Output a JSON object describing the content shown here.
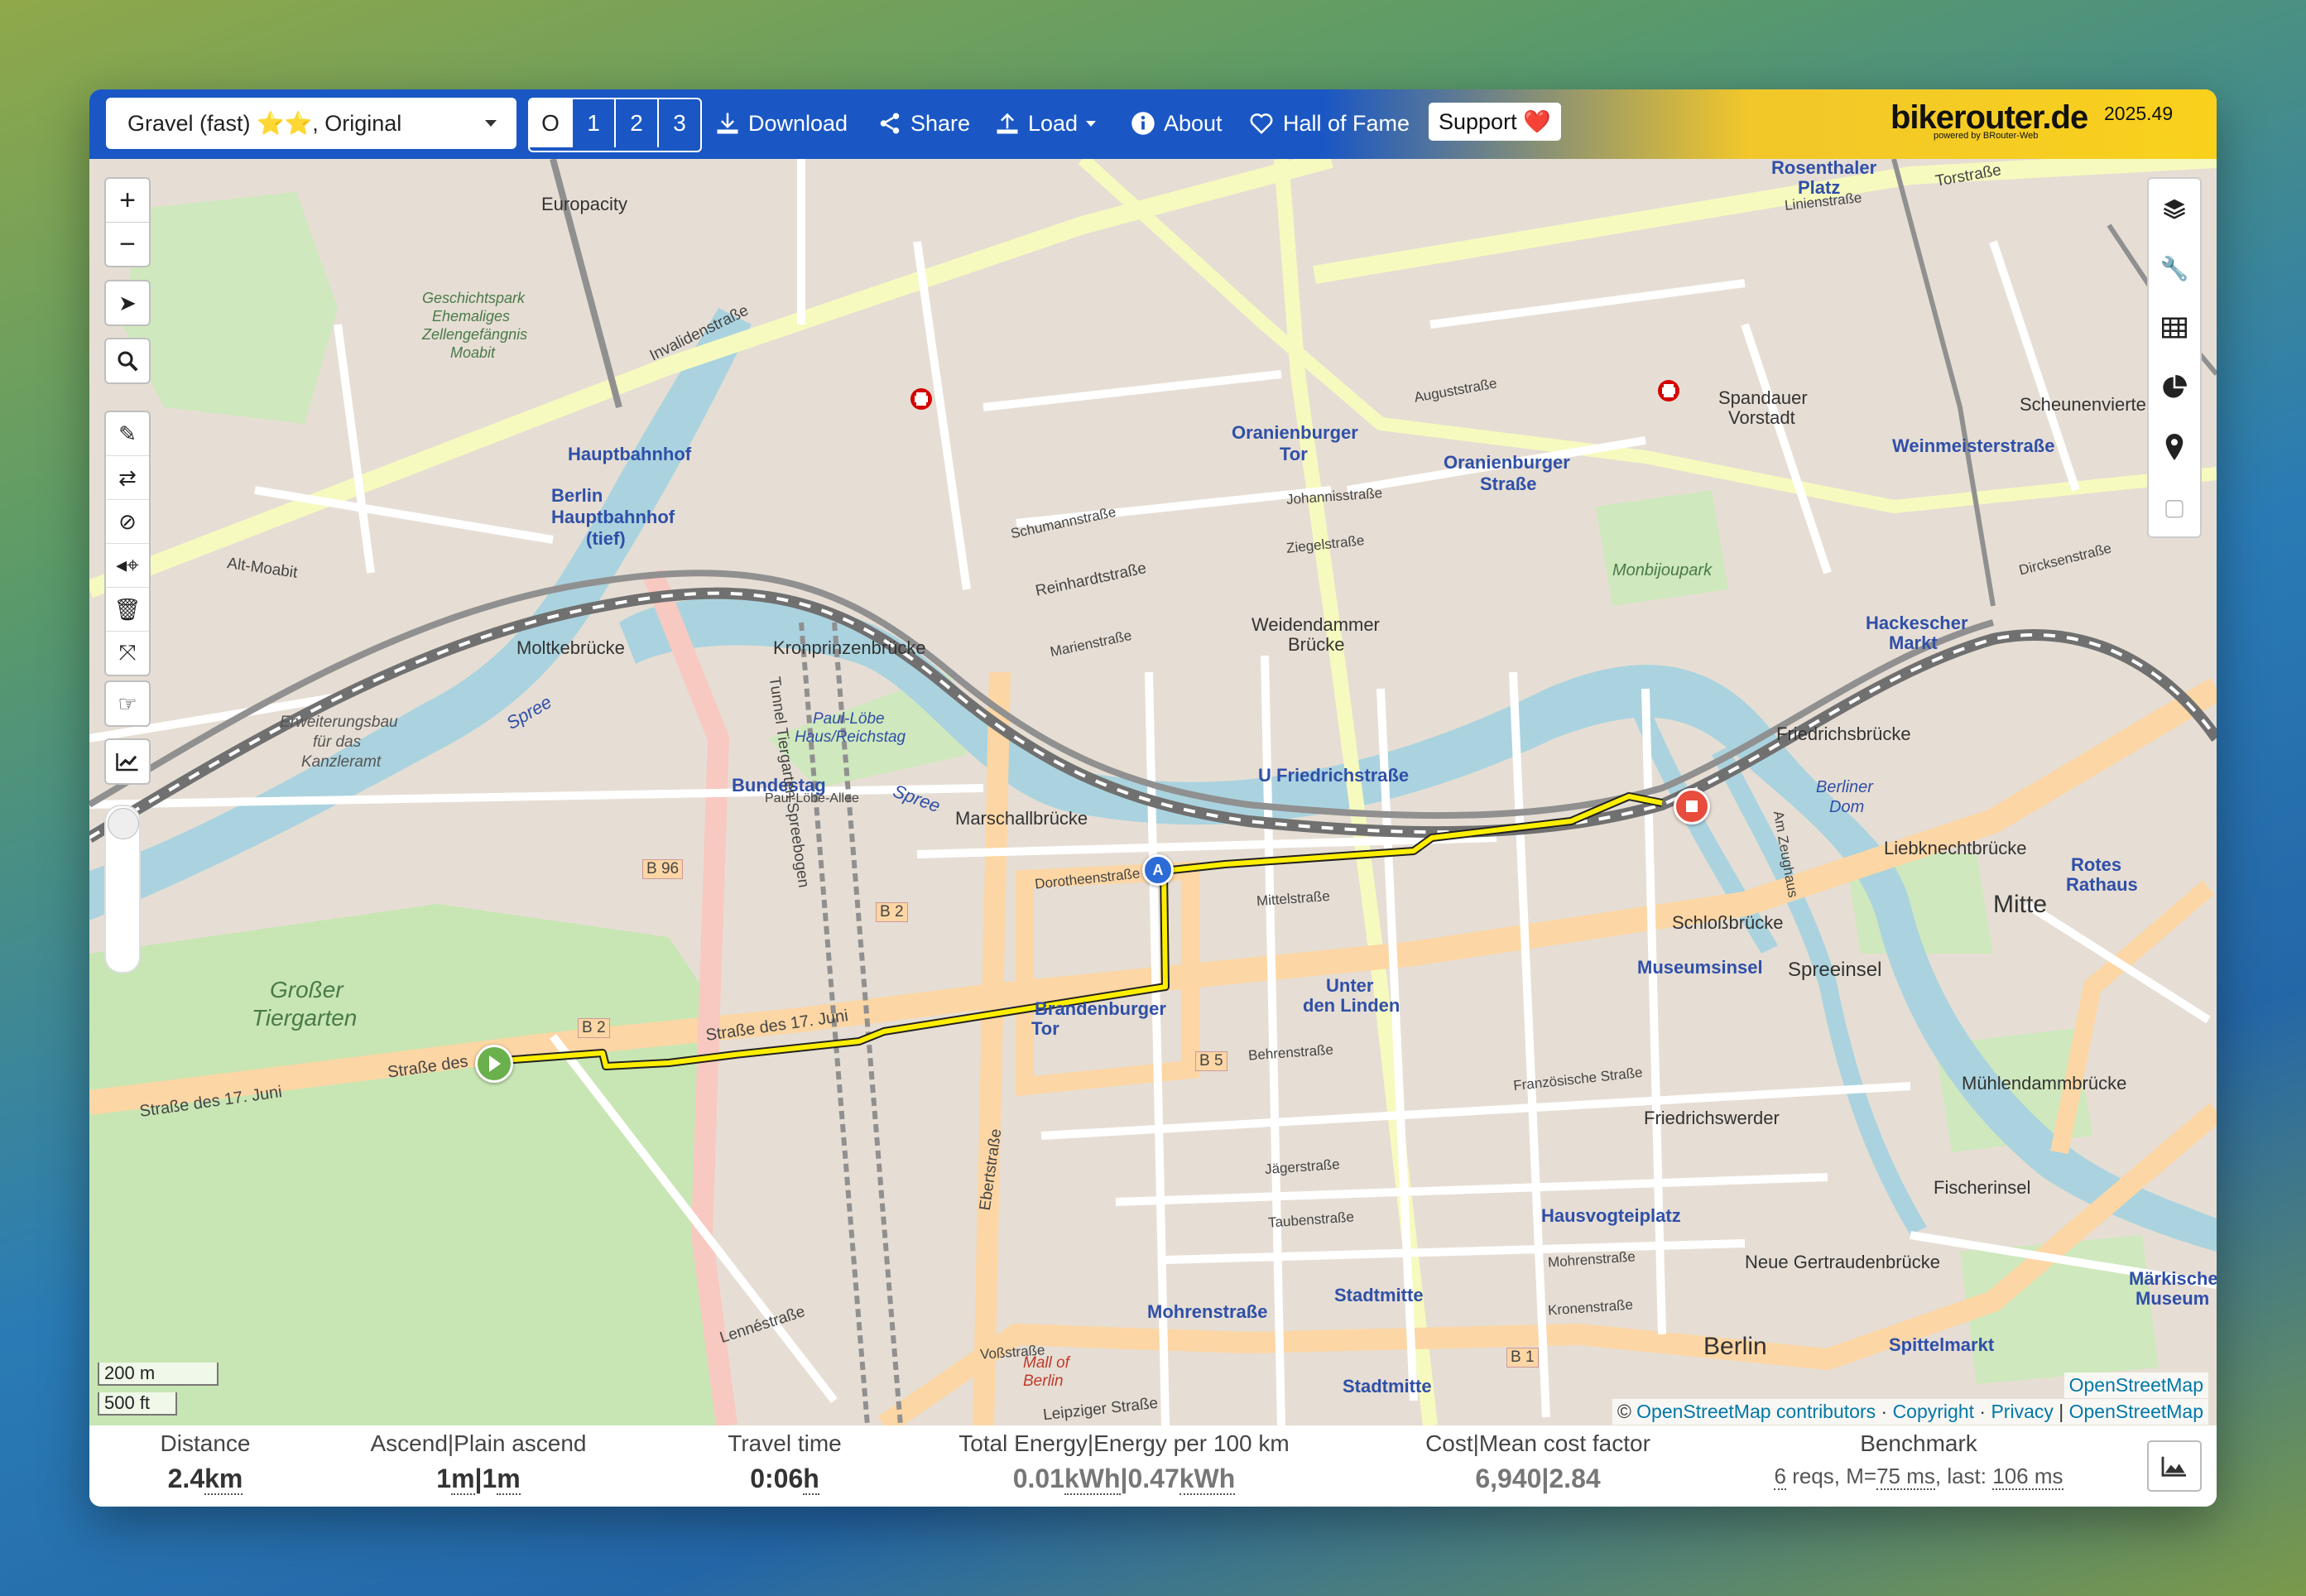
{
  "header": {
    "profile_select": "Gravel (fast) ⭐⭐, Original",
    "alternatives": [
      "O",
      "1",
      "2",
      "3"
    ],
    "download": "Download",
    "share": "Share",
    "load": "Load",
    "about": "About",
    "hall_of_fame": "Hall of Fame",
    "support": "Support ❤️",
    "brand": "bikerouter.de",
    "brand_sub": "powered by BRouter-Web",
    "version": "2025.49"
  },
  "map": {
    "labels": {
      "europacity": "Europacity",
      "hauptbahnhof": "Hauptbahnhof",
      "berlin_hbf": "Berlin",
      "berlin_hbf2": "Hauptbahnhof",
      "berlin_hbf3": "(tief)",
      "moltkebruecke": "Moltkebrücke",
      "kronprinzenbruecke": "Kronprinzenbrücke",
      "bundestag": "Bundestag",
      "paul_loebe_allee": "Paul-Löbe-Allee",
      "marschallbruecke": "Marschallbrücke",
      "grosser_tiergarten1": "Großer",
      "grosser_tiergarten2": "Tiergarten",
      "strasse_17_juni_a": "Straße des 17. Juni",
      "strasse_17_juni_b": "Straße des 17. Juni",
      "strasse_des": "Straße des",
      "oranienburger_tor1": "Oranienburger",
      "oranienburger_tor2": "Tor",
      "oranienburger_strasse1": "Oranienburger",
      "oranienburger_strasse2": "Straße",
      "weidendammer1": "Weidendammer",
      "weidendammer2": "Brücke",
      "friedrichstrasse": "U Friedrichstraße",
      "hackescher1": "Hackescher",
      "hackescher2": "Markt",
      "weinmeisterstrasse": "Weinmeisterstraße",
      "torstrasse": "Torstraße",
      "rosenthaler1": "Rosenthaler",
      "rosenthaler2": "Platz",
      "spandauer1": "Spandauer",
      "spandauer2": "Vorstadt",
      "scheunenviertel": "Scheunenviertel",
      "monbijoupark": "Monbijoupark",
      "friedrichsbruecke": "Friedrichsbrücke",
      "liebknechtbruecke": "Liebknechtbrücke",
      "berliner_dom1": "Berliner",
      "berliner_dom2": "Dom",
      "rotes_rathaus1": "Rotes",
      "rotes_rathaus2": "Rathaus",
      "mitte": "Mitte",
      "schlossbruecke": "Schloßbrücke",
      "museumsinsel": "Museumsinsel",
      "spreeinsel": "Spreeinsel",
      "unter_den_linden1": "Unter",
      "unter_den_linden2": "den Linden",
      "brandenburger_tor": "Brandenburger",
      "brandenburger_tor2": "Tor",
      "hausvogteiplatz": "Hausvogteiplatz",
      "stadtmitte": "Stadtmitte",
      "stadtmitte2": "Stadtmitte",
      "mohrenstrasse": "Mohrenstraße",
      "muehlendammbruecke": "Mühlendammbrücke",
      "fischerinsel": "Fischerinsel",
      "neue_gertrauden": "Neue Gertraudenbrücke",
      "berlin": "Berlin",
      "spittelmarkt": "Spittelmarkt",
      "maerkisches1": "Märkisches",
      "maerkisches2": "Museum",
      "friedrichswerder": "Friedrichswerder",
      "invalidenstrasse": "Invalidenstraße",
      "alt_moabit": "Alt-Moabit",
      "lennestrasse": "Lennéstraße",
      "leipziger": "Leipziger Straße",
      "ebertstrasse": "Ebertstraße",
      "tunnel_tiergarten": "Tunnel Tiergarten Spreebogen",
      "geschichtspark1": "Geschichtspark",
      "geschichtspark2": "Ehemaliges",
      "geschichtspark3": "Zellengefängnis",
      "geschichtspark4": "Moabit",
      "erweiterungsbau1": "Erweiterungsbau",
      "erweiterungsbau2": "für das",
      "erweiterungsbau3": "Kanzleramt",
      "poul_loebe1": "Paul-Löbe",
      "poul_loebe2": "Haus/Reichstag",
      "b96": "B 96",
      "b2a": "B 2",
      "b2b": "B 2",
      "b5": "B 5",
      "b1": "B 1",
      "spree": "Spree",
      "spree2": "Spree",
      "am_zeughaus": "Am Zeughaus",
      "reinhardtstrasse": "Reinhardtstraße",
      "schumannstrasse": "Schumannstraße",
      "dorotheenstrasse": "Dorotheenstraße",
      "mittelstrasse": "Mittelstraße",
      "behrenstrasse": "Behrenstraße",
      "franzoesische": "Französische Straße",
      "jaegerstrasse": "Jägerstraße",
      "taubenstrasse": "Taubenstraße",
      "kronenstrasse": "Kronenstraße",
      "mohrenstrasse_st": "Mohrenstraße",
      "vossstrasse": "Voßstraße",
      "mall_of_berlin1": "Mall of",
      "mall_of_berlin2": "Berlin",
      "auguststrasse": "Auguststraße",
      "ziegelstrasse": "Ziegelstraße",
      "johannisstrasse": "Johannisstraße",
      "marienstrasse": "Marienstraße",
      "dircksenstrasse": "Dircksenstraße",
      "linienstrasse": "Linienstraße"
    },
    "markers": {
      "start": "start-marker",
      "via": "A",
      "end": "end-marker"
    },
    "scale_metric": "200 m",
    "scale_imperial": "500 ft",
    "attribution_top": "OpenStreetMap",
    "attribution": {
      "copyright_symbol": "©",
      "osm_contributors": "OpenStreetMap contributors",
      "sep1": "·",
      "copyright": "Copyright",
      "sep2": "·",
      "privacy": "Privacy",
      "sep3": "|",
      "osm": "OpenStreetMap"
    }
  },
  "stats": {
    "distance_label": "Distance",
    "distance_value": "2.4",
    "distance_unit": "km",
    "ascend_label": "Ascend|Plain ascend",
    "ascend_value1": "1",
    "ascend_unit1": "m",
    "ascend_sep": "|",
    "ascend_value2": "1",
    "ascend_unit2": "m",
    "travel_label": "Travel time",
    "travel_value": "0:06",
    "travel_unit": "h",
    "energy_label": "Total Energy|Energy per 100 km",
    "energy_value1": "0.01",
    "energy_unit1": "kWh",
    "energy_sep": "|",
    "energy_value2": "0.47",
    "energy_unit2": "kWh",
    "cost_label": "Cost|Mean cost factor",
    "cost_value": "6,940|2.84",
    "benchmark_label": "Benchmark",
    "benchmark_reqs": "6",
    "benchmark_reqs_text": "reqs, M=",
    "benchmark_m": "75 ms",
    "benchmark_last_text": ", last:",
    "benchmark_last": "106 ms"
  }
}
